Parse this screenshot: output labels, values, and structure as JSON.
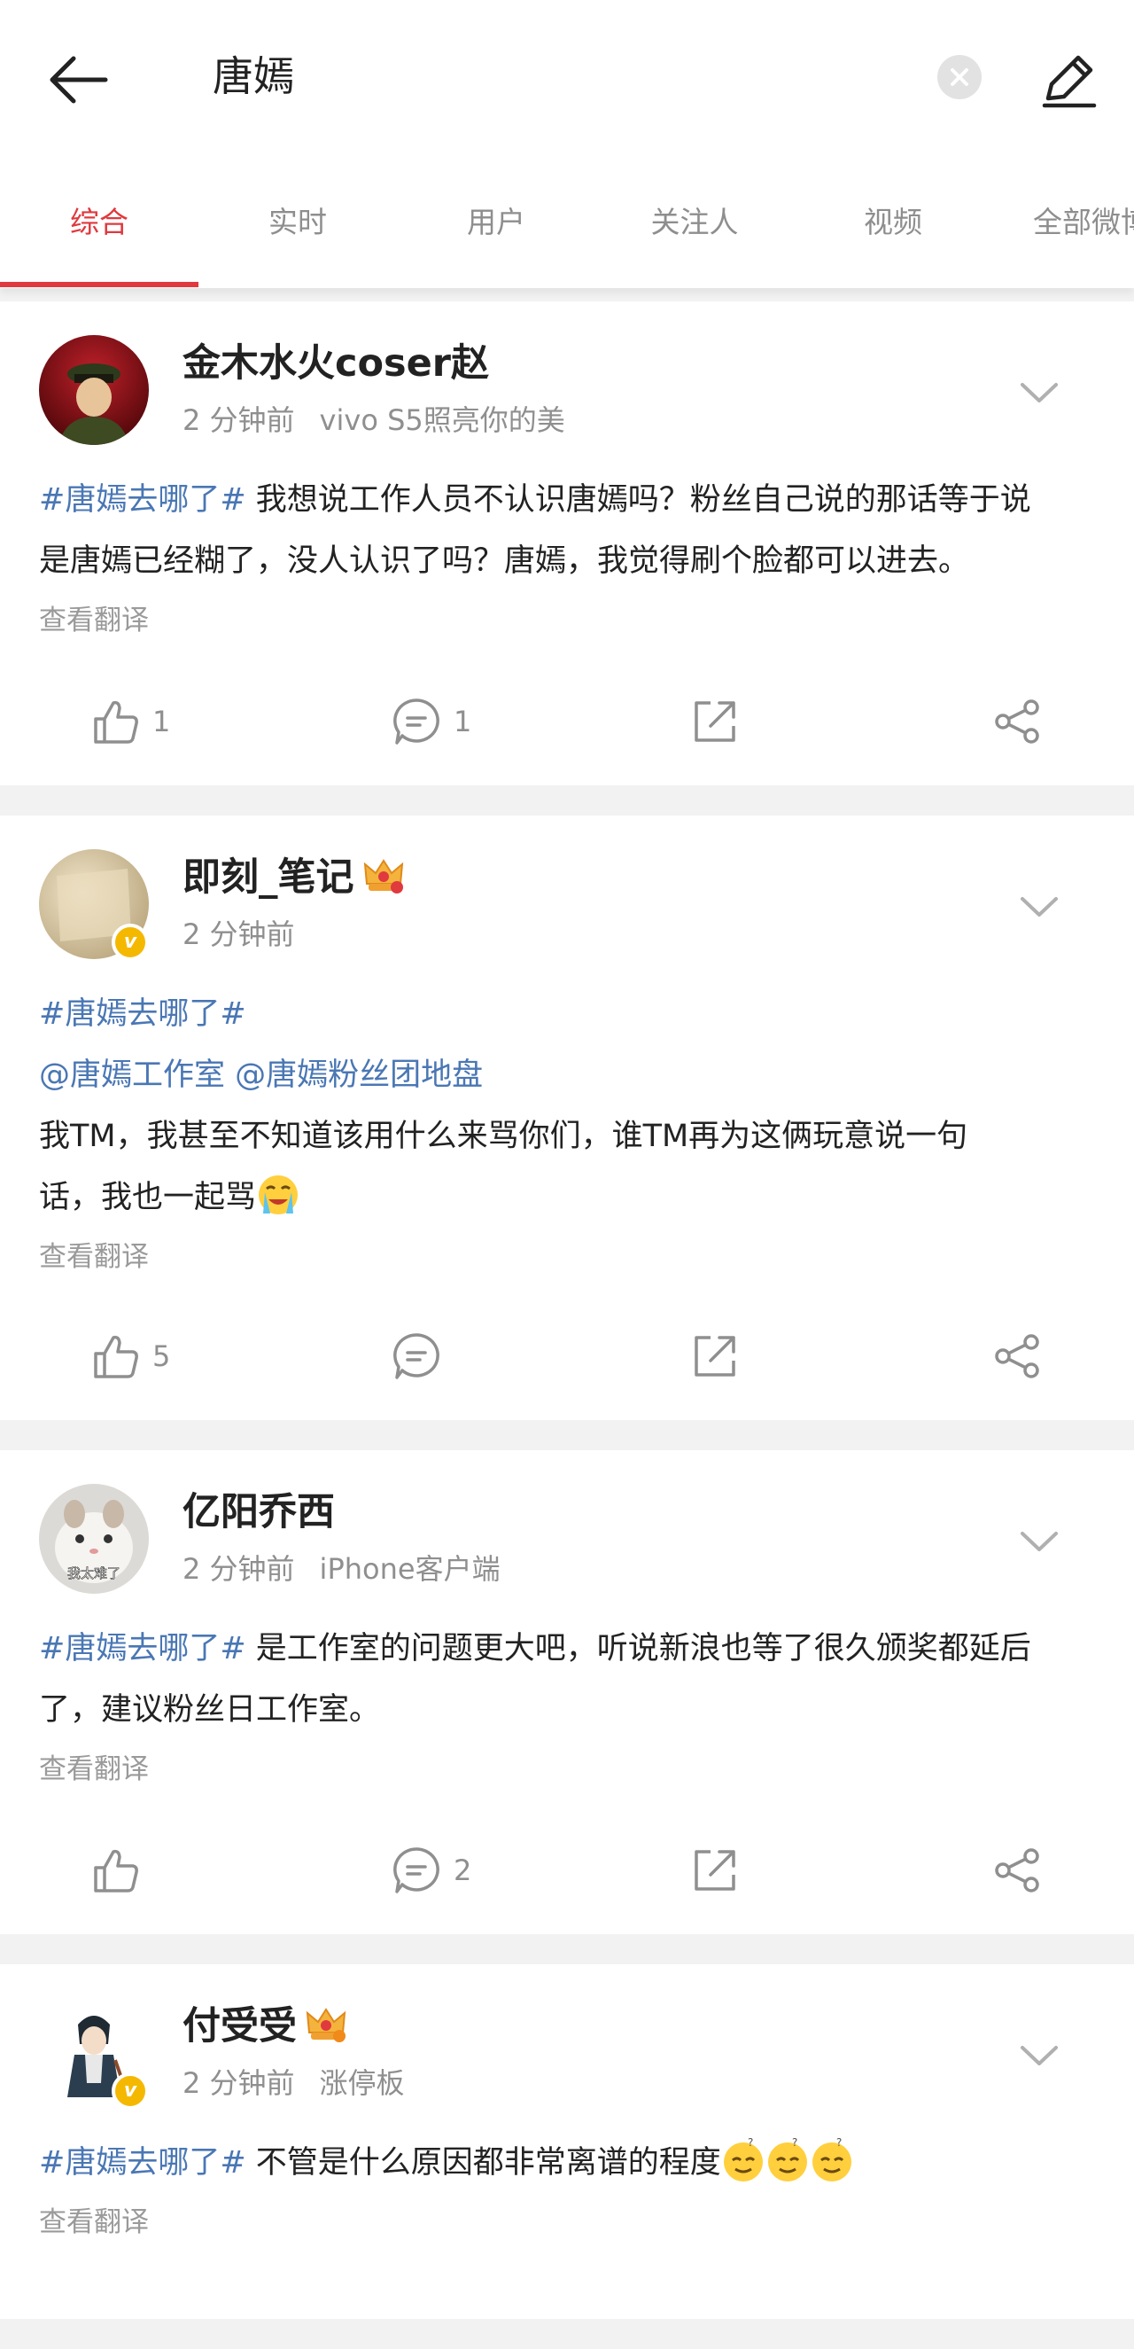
{
  "header": {
    "search_query": "唐嫣"
  },
  "tabs": [
    {
      "label": "综合",
      "active": true
    },
    {
      "label": "实时",
      "active": false
    },
    {
      "label": "用户",
      "active": false
    },
    {
      "label": "关注人",
      "active": false
    },
    {
      "label": "视频",
      "active": false
    },
    {
      "label": "全部微博",
      "active": false
    }
  ],
  "colors": {
    "accent": "#e0393e",
    "link": "#4a77b4",
    "muted": "#8f8f8f"
  },
  "posts": [
    {
      "user": "金木水火coser赵",
      "time": "2 分钟前",
      "source": "vivo S5照亮你的美",
      "lines": [
        {
          "tag": "#唐嫣去哪了#",
          "text": " 我想说工作人员不认识唐嫣吗？粉丝自己说的那话等于说"
        },
        {
          "text": "是唐嫣已经糊了，没人认识了吗？唐嫣，我觉得刷个脸都可以进去。"
        }
      ],
      "translate": "查看翻译",
      "likes": "1",
      "comments": "1"
    },
    {
      "user": "即刻_笔记",
      "time": "2 分钟前",
      "lines": [
        {
          "tag": "#唐嫣去哪了#"
        },
        {
          "mention": "@唐嫣工作室 @唐嫣粉丝团地盘"
        },
        {
          "text": "我TM，我甚至不知道该用什么来骂你们，谁TM再为这俩玩意说一句"
        },
        {
          "text": "话，我也一起骂"
        }
      ],
      "translate": "查看翻译",
      "likes": "5"
    },
    {
      "user": "亿阳乔西",
      "time": "2 分钟前",
      "source": "iPhone客户端",
      "avatar_caption": "我太难了",
      "lines": [
        {
          "tag": "#唐嫣去哪了#",
          "text": " 是工作室的问题更大吧，听说新浪也等了很久颁奖都延后"
        },
        {
          "text": "了，建议粉丝日工作室。"
        }
      ],
      "translate": "查看翻译",
      "comments": "2"
    },
    {
      "user": "付受受",
      "time": "2 分钟前",
      "source": "涨停板",
      "lines": [
        {
          "tag": "#唐嫣去哪了#",
          "text": " 不管是什么原因都非常离谱的程度"
        }
      ],
      "translate": "查看翻译"
    }
  ]
}
